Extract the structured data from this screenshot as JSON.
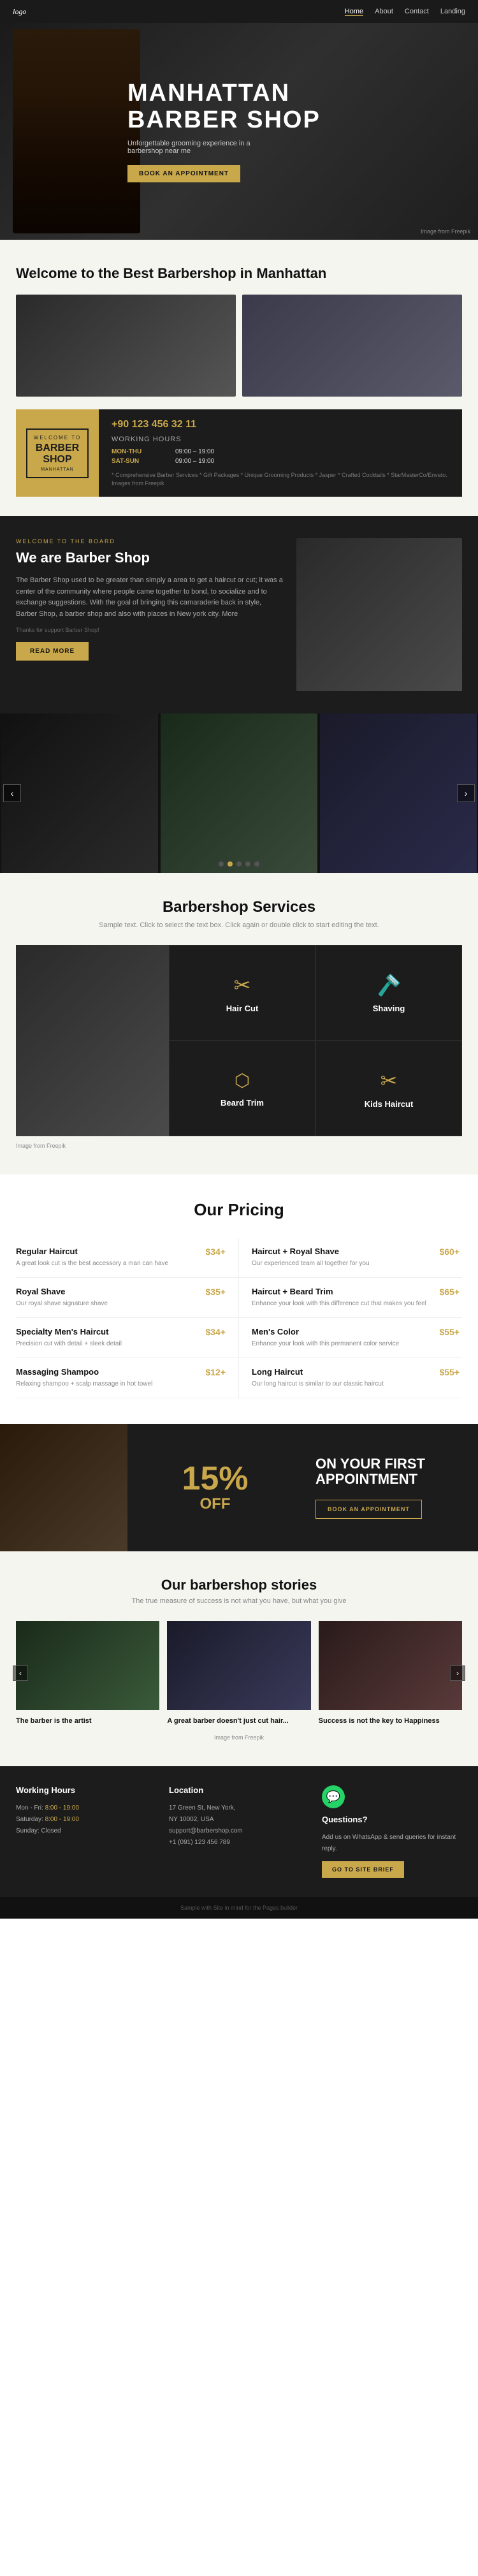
{
  "nav": {
    "logo": "logo",
    "links": [
      {
        "label": "Home",
        "active": true
      },
      {
        "label": "About",
        "active": false
      },
      {
        "label": "Contact",
        "active": false
      },
      {
        "label": "Landing",
        "active": false
      }
    ]
  },
  "hero": {
    "title_line1": "MANHATTAN",
    "title_line2": "BARBER SHOP",
    "subtitle": "Unforgettable grooming experience in a barbershop near me",
    "cta_button": "BOOK AN APPOINTMENT",
    "credit": "Image from Freepik"
  },
  "welcome": {
    "title": "Welcome to the Best Barbershop in Manhattan",
    "phone": "+90 123 456 32 11",
    "hours_title": "Working Hours",
    "hours": [
      {
        "days": "MON-THU",
        "time": "09:00 – 19:00"
      },
      {
        "days": "SAT-SUN",
        "time": "09:00 – 19:00"
      }
    ],
    "note": "* Comprehensive Barber Services * Gift Packages * Unique Grooming Products * Jasper * Crafted Cocktails * StarMasterCo/Envato. Images from Freepik",
    "badge": {
      "top": "WELCOME TO",
      "main": "BARBER",
      "main2": "SHOP",
      "sub": "MANHATTAN"
    }
  },
  "about": {
    "label": "WELCOME TO THE BOARD",
    "title": "We are Barber Shop",
    "text1": "The Barber Shop used to be greater than simply a area to get a haircut or cut; it was a center of the community where people came together to bond, to socialize and to exchange suggestions. With the goal of bringing this camaraderie back in style, Barber Shop, a barber shop and also with places in New york city. More",
    "credit": "Thanks for support Barber Shop!",
    "read_more": "READ MORE"
  },
  "carousel": {
    "dots": [
      false,
      true,
      false,
      false,
      false
    ],
    "prev": "‹",
    "next": "›"
  },
  "services": {
    "title": "Barbershop Services",
    "subtitle": "Sample text. Click to select the text box. Click again or double click to start editing the text.",
    "items": [
      {
        "name": "Hair Cut",
        "icon": "✂"
      },
      {
        "name": "Shaving",
        "icon": "🪒"
      },
      {
        "name": "Beard Trim",
        "icon": "⬡"
      },
      {
        "name": "Kids Haircut",
        "icon": "✂"
      }
    ],
    "credit": "Image from Freepik"
  },
  "pricing": {
    "title": "Our Pricing",
    "items": [
      {
        "name": "Regular Haircut",
        "price": "$34+",
        "desc": "A great look cut is the best accessory a man can have"
      },
      {
        "name": "Haircut + Royal Shave",
        "price": "$60+",
        "desc": "Our experienced team all together for you"
      },
      {
        "name": "Royal Shave",
        "price": "$35+",
        "desc": "Our royal shave signature shave"
      },
      {
        "name": "Haircut + Beard Trim",
        "price": "$65+",
        "desc": "Enhance your look with this difference cut that makes you feel"
      },
      {
        "name": "Specialty Men's Haircut",
        "price": "$34+",
        "desc": "Precision cut with detail + sleek detail"
      },
      {
        "name": "Men's Color",
        "price": "$55+",
        "desc": "Enhance your look with this permanent color service"
      },
      {
        "name": "Massaging Shampoo",
        "price": "$12+",
        "desc": "Relaxing shampoo + scalp massage in hot towel"
      },
      {
        "name": "Long Haircut",
        "price": "$55+",
        "desc": "Our long haircut is similar to our classic haircut"
      }
    ]
  },
  "promo": {
    "percent": "15%",
    "off": "OFF",
    "title": "ON YOUR FIRST APPOINTMENT",
    "cta": "BOOK AN APPOINTMENT"
  },
  "stories": {
    "title": "Our barbershop stories",
    "subtitle": "The true measure of success is not what you have, but what you give",
    "items": [
      {
        "caption": "The barber is the artist"
      },
      {
        "caption": "A great barber doesn't just cut hair..."
      },
      {
        "caption": "Success is not the key to Happiness"
      }
    ],
    "credit": "Image from Freepik"
  },
  "footer": {
    "hours_title": "Working Hours",
    "hours": [
      {
        "days": "Mon - Fri:",
        "time": "8:00 - 19:00"
      },
      {
        "days": "Saturday:",
        "time": "8:00 - 19:00"
      },
      {
        "days": "Sunday:",
        "time": "Closed"
      }
    ],
    "location_title": "Location",
    "address1": "17 Green St, New York,",
    "address2": "NY 10002, USA",
    "email": "support@barbershop.com",
    "phone_contact": "+1 (091) 123 456 789",
    "questions_title": "Questions?",
    "questions_desc": "Add us on WhatsApp & send queries for instant reply.",
    "contact_btn": "GO TO SITE BRIEF",
    "bottom_text": "Sample with Site in mind for the Pages builder"
  }
}
